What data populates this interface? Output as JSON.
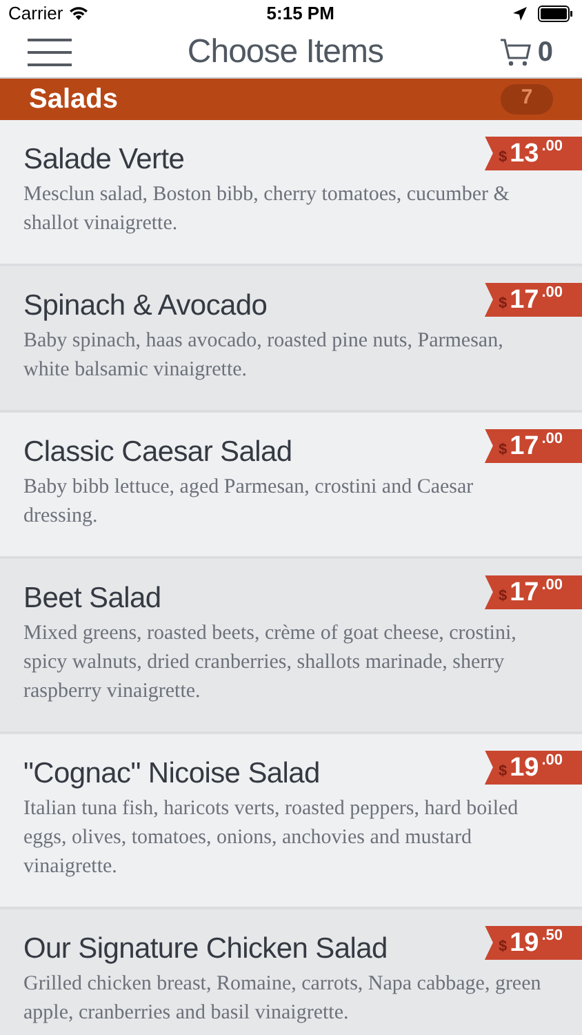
{
  "status_bar": {
    "carrier": "Carrier",
    "time": "5:15 PM"
  },
  "nav": {
    "title": "Choose Items",
    "cart_count": "0"
  },
  "section": {
    "title": "Salads",
    "count": "7"
  },
  "items": [
    {
      "name": "Salade Verte",
      "description": "Mesclun salad, Boston bibb, cherry tomatoes, cucumber & shallot vinaigrette.",
      "currency": "$",
      "price": "13",
      "cents": ".00"
    },
    {
      "name": "Spinach & Avocado",
      "description": "Baby spinach, haas avocado, roasted pine nuts, Parmesan, white balsamic vinaigrette.",
      "currency": "$",
      "price": "17",
      "cents": ".00"
    },
    {
      "name": "Classic Caesar Salad",
      "description": "Baby bibb lettuce, aged Parmesan, crostini and Caesar dressing.",
      "currency": "$",
      "price": "17",
      "cents": ".00"
    },
    {
      "name": "Beet Salad",
      "description": "Mixed greens, roasted beets, crème of goat cheese, crostini, spicy walnuts, dried cranberries, shallots marinade, sherry raspberry vinaigrette.",
      "currency": "$",
      "price": "17",
      "cents": ".00"
    },
    {
      "name": "\"Cognac\" Nicoise Salad",
      "description": "Italian tuna fish, haricots verts, roasted peppers, hard boiled eggs, olives, tomatoes, onions, anchovies and mustard vinaigrette.",
      "currency": "$",
      "price": "19",
      "cents": ".00"
    },
    {
      "name": "Our Signature Chicken Salad",
      "description": "Grilled chicken breast, Romaine, carrots, Napa cabbage, green apple, cranberries and basil vinaigrette.",
      "currency": "$",
      "price": "19",
      "cents": ".50"
    }
  ]
}
